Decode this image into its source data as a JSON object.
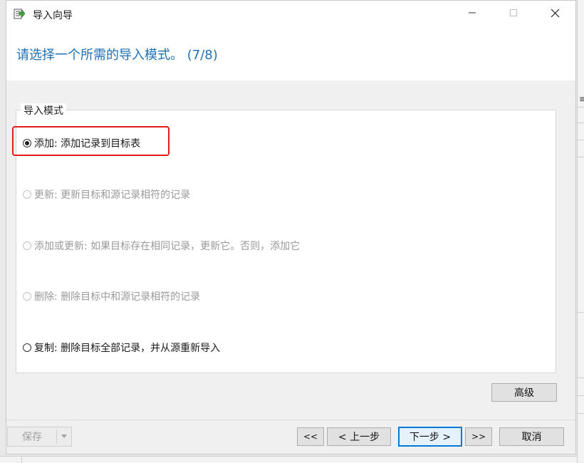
{
  "window": {
    "title": "导入向导"
  },
  "wizard": {
    "heading": "请选择一个所需的导入模式。 (7/8)"
  },
  "import_mode": {
    "legend": "导入模式",
    "options": [
      {
        "label": "添加: 添加记录到目标表",
        "selected": true,
        "enabled": true
      },
      {
        "label": "更新: 更新目标和源记录相符的记录",
        "selected": false,
        "enabled": false
      },
      {
        "label": "添加或更新: 如果目标存在相同记录，更新它。否则，添加它",
        "selected": false,
        "enabled": false
      },
      {
        "label": "删除: 删除目标中和源记录相符的记录",
        "selected": false,
        "enabled": false
      },
      {
        "label": "复制: 删除目标全部记录，并从源重新导入",
        "selected": false,
        "enabled": true
      }
    ]
  },
  "buttons": {
    "advanced": "高级",
    "save": "保存",
    "first": "<<",
    "prev": "< 上一步",
    "next": "下一步 >",
    "last": ">>",
    "cancel": "取消"
  },
  "colors": {
    "heading": "#1f6fb4",
    "highlight": "#e21d1d",
    "focus": "#0078d7"
  },
  "icons": {
    "app": "import-wizard-icon",
    "minimize": "minimize-icon",
    "maximize": "maximize-icon",
    "close": "close-icon",
    "save_dropdown": "chevron-down-icon"
  }
}
